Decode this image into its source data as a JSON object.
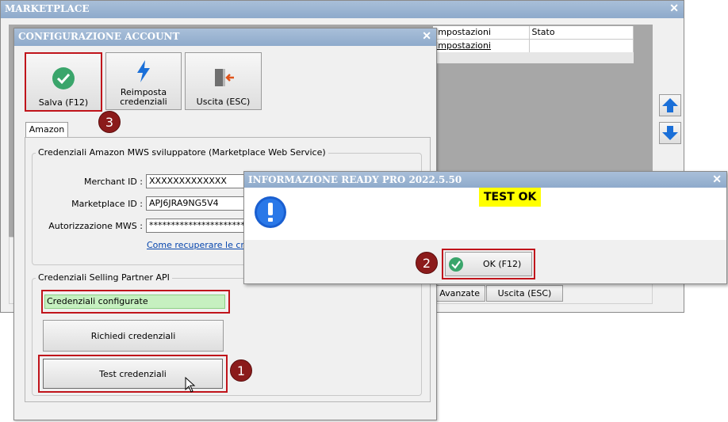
{
  "marketplace": {
    "title": "MARKETPLACE",
    "grid_headers": [
      "Impostazioni",
      "Stato"
    ],
    "grid_row": [
      "Impostazioni",
      ""
    ],
    "avanzate_label": "Avanzate",
    "uscita_label": "Uscita (ESC)"
  },
  "config": {
    "title": "CONFIGURAZIONE ACCOUNT",
    "toolbar": {
      "save_label": "Salva (F12)",
      "reset_label": "Reimposta\ncredenziali",
      "exit_label": "Uscita (ESC)"
    },
    "tab_label": "Amazon",
    "mws_group_label": "Credenziali Amazon MWS sviluppatore (Marketplace Web Service)",
    "merchant_label": "Merchant ID :",
    "merchant_value": "XXXXXXXXXXXXX",
    "marketplace_id_label": "Marketplace ID :",
    "marketplace_id_value": "APJ6JRA9NG5V4",
    "auth_label": "Autorizzazione MWS :",
    "auth_value": "**************************",
    "recover_link": "Come recuperare le credenziali",
    "sp_group_label": "Credenziali Selling Partner API",
    "sp_status": "Credenziali configurate",
    "request_button": "Richiedi credenziali",
    "test_button": "Test credenziali"
  },
  "dialog": {
    "title": "INFORMAZIONE READY PRO 2022.5.50",
    "message": "TEST OK",
    "ok_label": "OK (F12)"
  },
  "annotations": [
    "1",
    "2",
    "3"
  ],
  "colors": {
    "titlebar": "#9bb5d4",
    "highlight_red": "#c0141b",
    "badge": "#8b1b1b",
    "success_green": "#c6f0c0",
    "message_yellow": "#ffff00",
    "check_green": "#3aa56b",
    "info_blue": "#1a5fd0"
  }
}
